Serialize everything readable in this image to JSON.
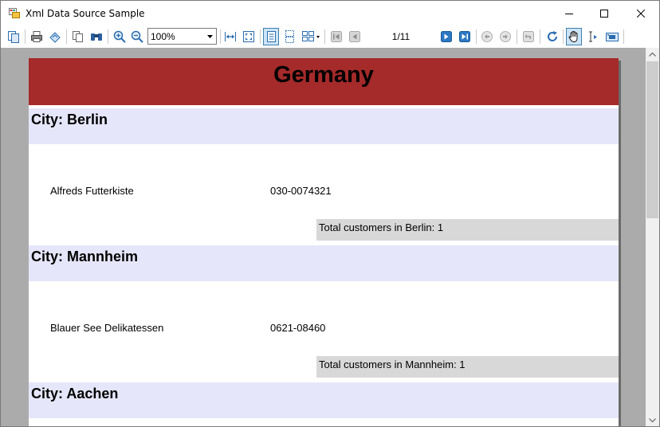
{
  "window": {
    "title": "Xml Data Source Sample"
  },
  "toolbar": {
    "zoom_value": "100%",
    "page_counter": "1/11"
  },
  "report": {
    "country": "Germany",
    "groups": [
      {
        "city_label": "City: Berlin",
        "customer": "Alfreds Futterkiste",
        "phone": "030-0074321",
        "total": "Total customers in Berlin: 1"
      },
      {
        "city_label": "City: Mannheim",
        "customer": "Blauer See Delikatessen",
        "phone": "0621-08460",
        "total": "Total customers in Mannheim: 1"
      },
      {
        "city_label": "City: Aachen"
      }
    ]
  },
  "colors": {
    "banner": "#a52a2a",
    "city_header": "#e6e6fa",
    "total_box": "#d8d8d8",
    "viewer_bg": "#ababab"
  }
}
